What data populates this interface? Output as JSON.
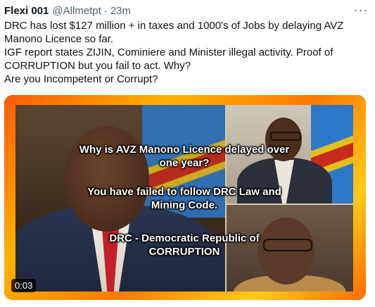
{
  "tweet": {
    "author_name": "Flexi 001",
    "author_handle": "@Allmetpt",
    "separator": "·",
    "time": "23m",
    "more_icon": "more-dots-icon",
    "text_lines": [
      "DRC has lost $127 million + in taxes and 1000's of Jobs by delaying AVZ",
      "Manono Licence so far.",
      "IGF report states ZIJIN, Cominiere and Minister illegal activity. Proof of",
      "CORRUPTION but you fail to act. Why?",
      "Are you Incompetent or Corrupt?"
    ]
  },
  "media": {
    "overlay_lines": [
      "Why is AVZ Manono Licence delayed over",
      "one year?",
      "You have failed to follow DRC Law and",
      "Mining Code.",
      "DRC - Democratic Republic of",
      "CORRUPTION"
    ],
    "video_timestamp": "0:03",
    "frame_colors": [
      "#ff5a00",
      "#ffb200"
    ]
  }
}
